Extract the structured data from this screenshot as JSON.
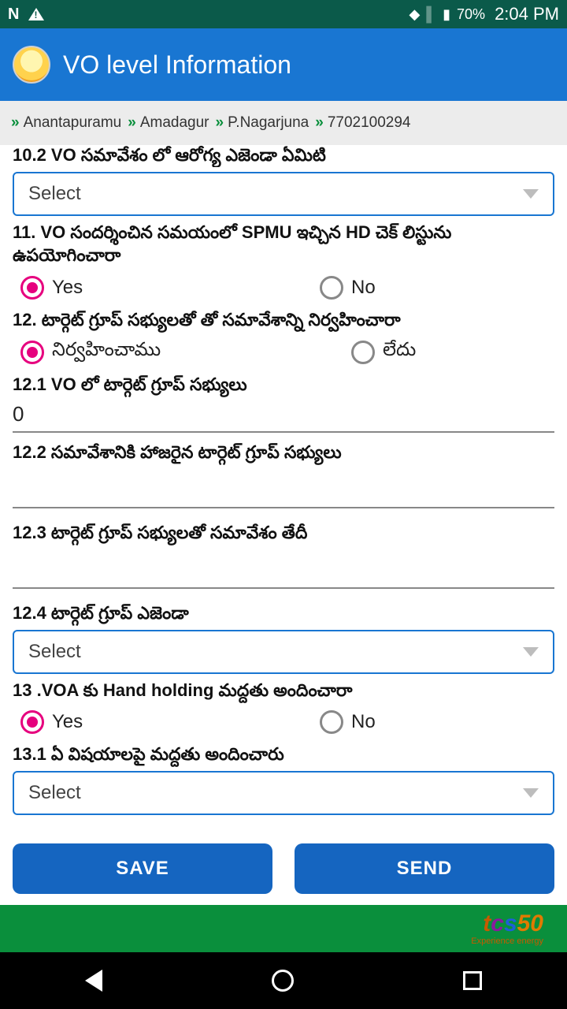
{
  "status": {
    "battery": "70%",
    "time": "2:04 PM"
  },
  "appbar": {
    "title": "VO level Information"
  },
  "breadcrumb": {
    "b1": "Anantapuramu",
    "b2": "Amadagur",
    "b3": "P.Nagarjuna",
    "b4": "7702100294"
  },
  "form": {
    "q10_2": "10.2 VO సమావేశం లో ఆరోగ్య ఎజెండా ఏమిటి",
    "select_placeholder": "Select",
    "q11": "11. VO సందర్శించిన సమయంలో SPMU ఇచ్చిన HD చెక్ లిస్టును ఉపయోగించారా",
    "yes": "Yes",
    "no": "No",
    "q12": "12. టార్గెట్ గ్రూప్ సభ్యులతో తో సమావేశాన్ని నిర్వహించారా",
    "opt_conducted": "నిర్వహించాము",
    "opt_no": "లేదు",
    "q12_1": "12.1 VO లో టార్గెట్ గ్రూప్ సభ్యులు",
    "val_12_1": "0",
    "q12_2": "12.2 సమావేశానికి హాజరైన టార్గెట్ గ్రూప్ సభ్యులు",
    "q12_3": "12.3 టార్గెట్  గ్రూప్ సభ్యులతో సమావేశం తేదీ",
    "q12_4": "12.4 టార్గెట్ గ్రూప్ ఎజెండా",
    "q13": "13 .VOA కు Hand holding మద్దతు అందించారా",
    "q13_1": "13.1 ఏ విషయాలపై మద్దతు అందించారు"
  },
  "actions": {
    "save": "SAVE",
    "send": "SEND"
  },
  "brand": {
    "sub": "Experience energy"
  }
}
